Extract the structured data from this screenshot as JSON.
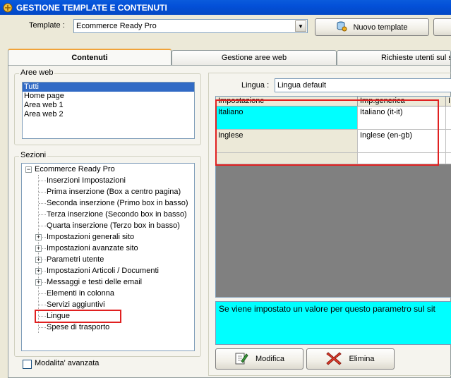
{
  "window": {
    "title": "GESTIONE TEMPLATE E CONTENUTI"
  },
  "template_bar": {
    "label": "Template :",
    "selected": "Ecommerce Ready Pro",
    "new_button": "Nuovo template"
  },
  "tabs": [
    {
      "label": "Contenuti"
    },
    {
      "label": "Gestione aree web"
    },
    {
      "label": "Richieste utenti sul si"
    }
  ],
  "aree_web": {
    "title": "Aree web",
    "items": [
      "Tutti",
      "Home page",
      "Area web 1",
      "Area web 2"
    ]
  },
  "sezioni": {
    "title": "Sezioni",
    "root": "Ecommerce Ready Pro",
    "items": [
      "Inserzioni Impostazioni",
      "Prima inserzione (Box a centro pagina)",
      "Seconda inserzione (Primo box in basso)",
      "Terza inserzione (Secondo box in basso)",
      "Quarta inserzione (Terzo box in basso)",
      "Impostazioni generali sito",
      "Impostazioni avanzate sito",
      "Parametri utente",
      "Impostazioni Articoli / Documenti",
      "Messaggi e testi delle email",
      "Elementi in colonna",
      "Servizi aggiuntivi",
      "Lingue",
      "Spese di trasporto"
    ]
  },
  "lingua": {
    "label": "Lingua :",
    "value": "Lingua default"
  },
  "grid": {
    "headers": [
      "Impostazione",
      "Imp.generica",
      "I"
    ],
    "rows": [
      [
        "Italiano",
        "Italiano (it-it)"
      ],
      [
        "Inglese",
        "Inglese (en-gb)"
      ]
    ]
  },
  "description": "Se viene impostato un valore per questo parametro sul sit",
  "buttons": {
    "modifica": "Modifica",
    "elimina": "Elimina"
  },
  "advanced": {
    "label": "Modalita' avanzata"
  }
}
